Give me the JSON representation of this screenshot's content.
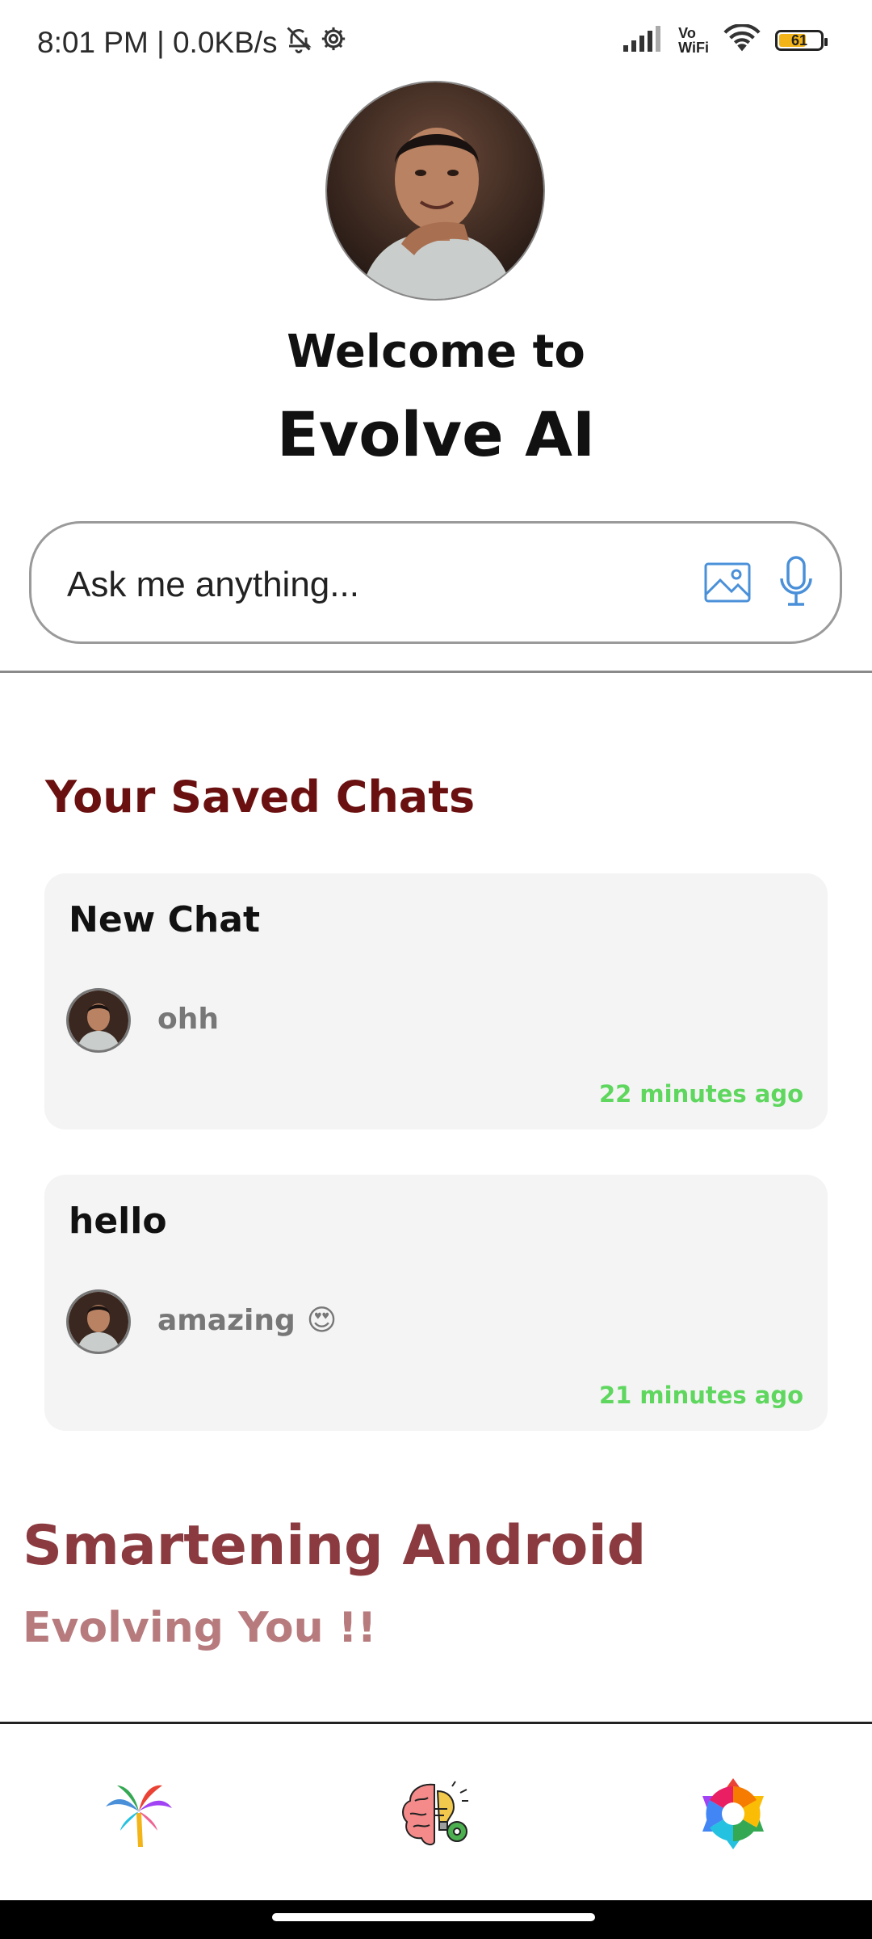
{
  "status_bar": {
    "left_text": "8:01 PM | 0.0KB/s",
    "vowifi_top": "Vo",
    "vowifi_bottom": "WiFi",
    "battery": "61"
  },
  "header": {
    "welcome": "Welcome to",
    "app_name": "Evolve AI"
  },
  "search": {
    "placeholder": "Ask me anything..."
  },
  "saved_chats": {
    "title": "Your Saved Chats",
    "items": [
      {
        "title": "New Chat",
        "preview": "ohh",
        "emoji": "",
        "time": "22 minutes ago"
      },
      {
        "title": "hello",
        "preview": "amazing",
        "emoji": "😍",
        "time": "21 minutes ago"
      }
    ]
  },
  "tagline": {
    "line1": "Smartening Android",
    "line2": "Evolving You !!"
  },
  "bottom_nav": {
    "items": [
      "palm-tree-icon",
      "brain-idea-icon",
      "settings-gear-icon"
    ]
  },
  "colors": {
    "section_title": "#6b1010",
    "tagline1": "#8b3a3f",
    "tagline2": "#b77b7e",
    "time_green": "#5fd75f",
    "icon_blue": "#4a90d9"
  }
}
